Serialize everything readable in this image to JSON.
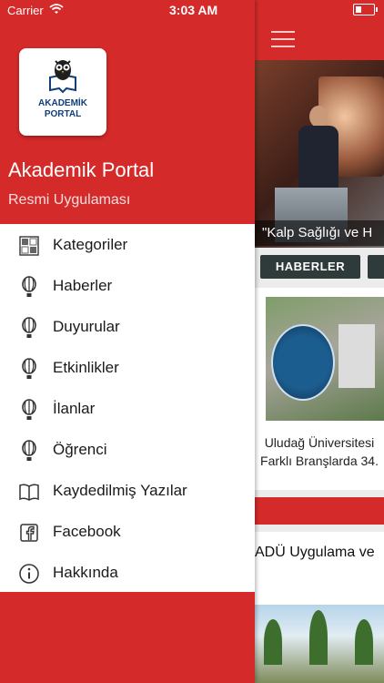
{
  "status_bar": {
    "carrier": "Carrier",
    "time": "3:03 AM"
  },
  "colors": {
    "brand_red": "#d42a2a",
    "dark_button": "#2f3a3a"
  },
  "drawer": {
    "logo": {
      "line1": "AKADEMİK",
      "line2": "PORTAL"
    },
    "title": "Akademik Portal",
    "subtitle": "Resmi Uygulaması",
    "items": [
      {
        "label": "Kategoriler",
        "icon": "grid-icon"
      },
      {
        "label": "Haberler",
        "icon": "balloon-icon"
      },
      {
        "label": "Duyurular",
        "icon": "balloon-icon"
      },
      {
        "label": "Etkinlikler",
        "icon": "balloon-icon"
      },
      {
        "label": "İlanlar",
        "icon": "balloon-icon"
      },
      {
        "label": "Öğrenci",
        "icon": "balloon-icon"
      },
      {
        "label": "Kaydedilmiş Yazılar",
        "icon": "book-icon"
      },
      {
        "label": "Facebook",
        "icon": "facebook-icon"
      },
      {
        "label": "Hakkında",
        "icon": "info-icon"
      }
    ]
  },
  "background": {
    "hero_caption": "\"Kalp Sağlığı ve H",
    "news_button": "HABERLER",
    "card_line1": "Uludağ Üniversitesi",
    "card_line2": "Farklı Branşlarda 34.",
    "second_title": "ADÜ Uygulama ve"
  }
}
